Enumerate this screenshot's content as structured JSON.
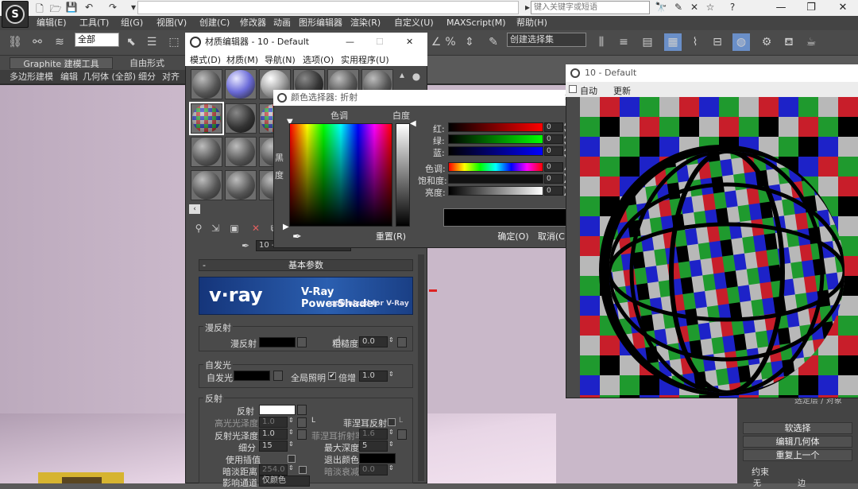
{
  "app": {
    "logo_letter": "S",
    "search_placeholder": "键入关键字或短语"
  },
  "window_controls": [
    "—",
    "❐",
    "✕"
  ],
  "menubar": [
    "编辑(E)",
    "工具(T)",
    "组(G)",
    "视图(V)",
    "创建(C)",
    "修改器",
    "动画",
    "图形编辑器",
    "渲染(R)",
    "自定义(U)",
    "MAXScript(M)",
    "帮助(H)"
  ],
  "toolbar": {
    "selection_filter": "全部",
    "named_selection": "创建选择集"
  },
  "ribbon": {
    "tabs": [
      "Graphite 建模工具",
      "自由形式"
    ],
    "subtabs": [
      "多边形建模",
      "编辑",
      "几何体 (全部)",
      "细分",
      "对齐"
    ]
  },
  "material_editor": {
    "title": "材质编辑器 - 10 - Default",
    "menus": [
      "模式(D)",
      "材质(M)",
      "导航(N)",
      "选项(O)",
      "实用程序(U)"
    ],
    "material_name": "10 - ",
    "rollout_title": "基本参数",
    "vray_logo": "v·ray",
    "vray_title": "V-Ray PowerShader",
    "vray_sub": "optimized for V-Ray",
    "diffuse": {
      "group": "漫反射",
      "diffuse_label": "漫反射",
      "roughness_label": "粗糙度",
      "roughness_value": "0.0"
    },
    "selfillum": {
      "group": "自发光",
      "label": "自发光",
      "gi_label": "全局照明",
      "gi_checked": "✔",
      "mult_label": "倍增",
      "mult_value": "1.0"
    },
    "reflection": {
      "group": "反射",
      "reflect_label": "反射",
      "hilight_gloss_label": "高光光泽度",
      "hilight_gloss_value": "1.0",
      "lock_label": "L",
      "fresnel_label": "菲涅耳反射",
      "fresnel_lock": "L",
      "refl_gloss_label": "反射光泽度",
      "refl_gloss_value": "1.0",
      "fresnel_ior_label": "菲涅耳折射率",
      "fresnel_ior_value": "1.6",
      "subdivs_label": "细分",
      "subdivs_value": "15",
      "max_depth_label": "最大深度",
      "max_depth_value": "5",
      "use_interp_label": "使用插值",
      "exit_color_label": "退出颜色",
      "dim_dist_label": "暗淡距离",
      "dim_dist_value": "254.0",
      "dim_falloff_label": "暗淡衰减",
      "dim_falloff_value": "0.0",
      "affect_channels_label": "影响通道",
      "affect_channels_value": "仅颜色"
    }
  },
  "color_selector": {
    "title": "颜色选择器: 折射",
    "hue_label": "色调",
    "whiteness_label": "白度",
    "black_label": "黑",
    "degree_label": "度",
    "channels": [
      {
        "label": "红:",
        "value": "0"
      },
      {
        "label": "绿:",
        "value": "0"
      },
      {
        "label": "蓝:",
        "value": "0"
      },
      {
        "label": "色调:",
        "value": "0"
      },
      {
        "label": "饱和度:",
        "value": "0"
      },
      {
        "label": "亮度:",
        "value": "0"
      }
    ],
    "reset_label": "重置(R)",
    "ok_label": "确定(O)",
    "cancel_label": "取消(C)"
  },
  "render_window": {
    "title": "10 - Default",
    "auto_label": "自动",
    "update_label": "更新"
  },
  "command_panel": {
    "hint": "选定层 / 对象",
    "items": [
      "软选择",
      "编辑几何体",
      "重复上一个"
    ],
    "constraints_label": "约束",
    "radio1": "无",
    "radio2": "边"
  },
  "colors": {
    "checker_red": "#c81e2a",
    "checker_green": "#1f9a2e",
    "checker_blue": "#1d22c8",
    "checker_gray": "#b8b8b8",
    "viewport_bg": "#c9b8c9"
  }
}
